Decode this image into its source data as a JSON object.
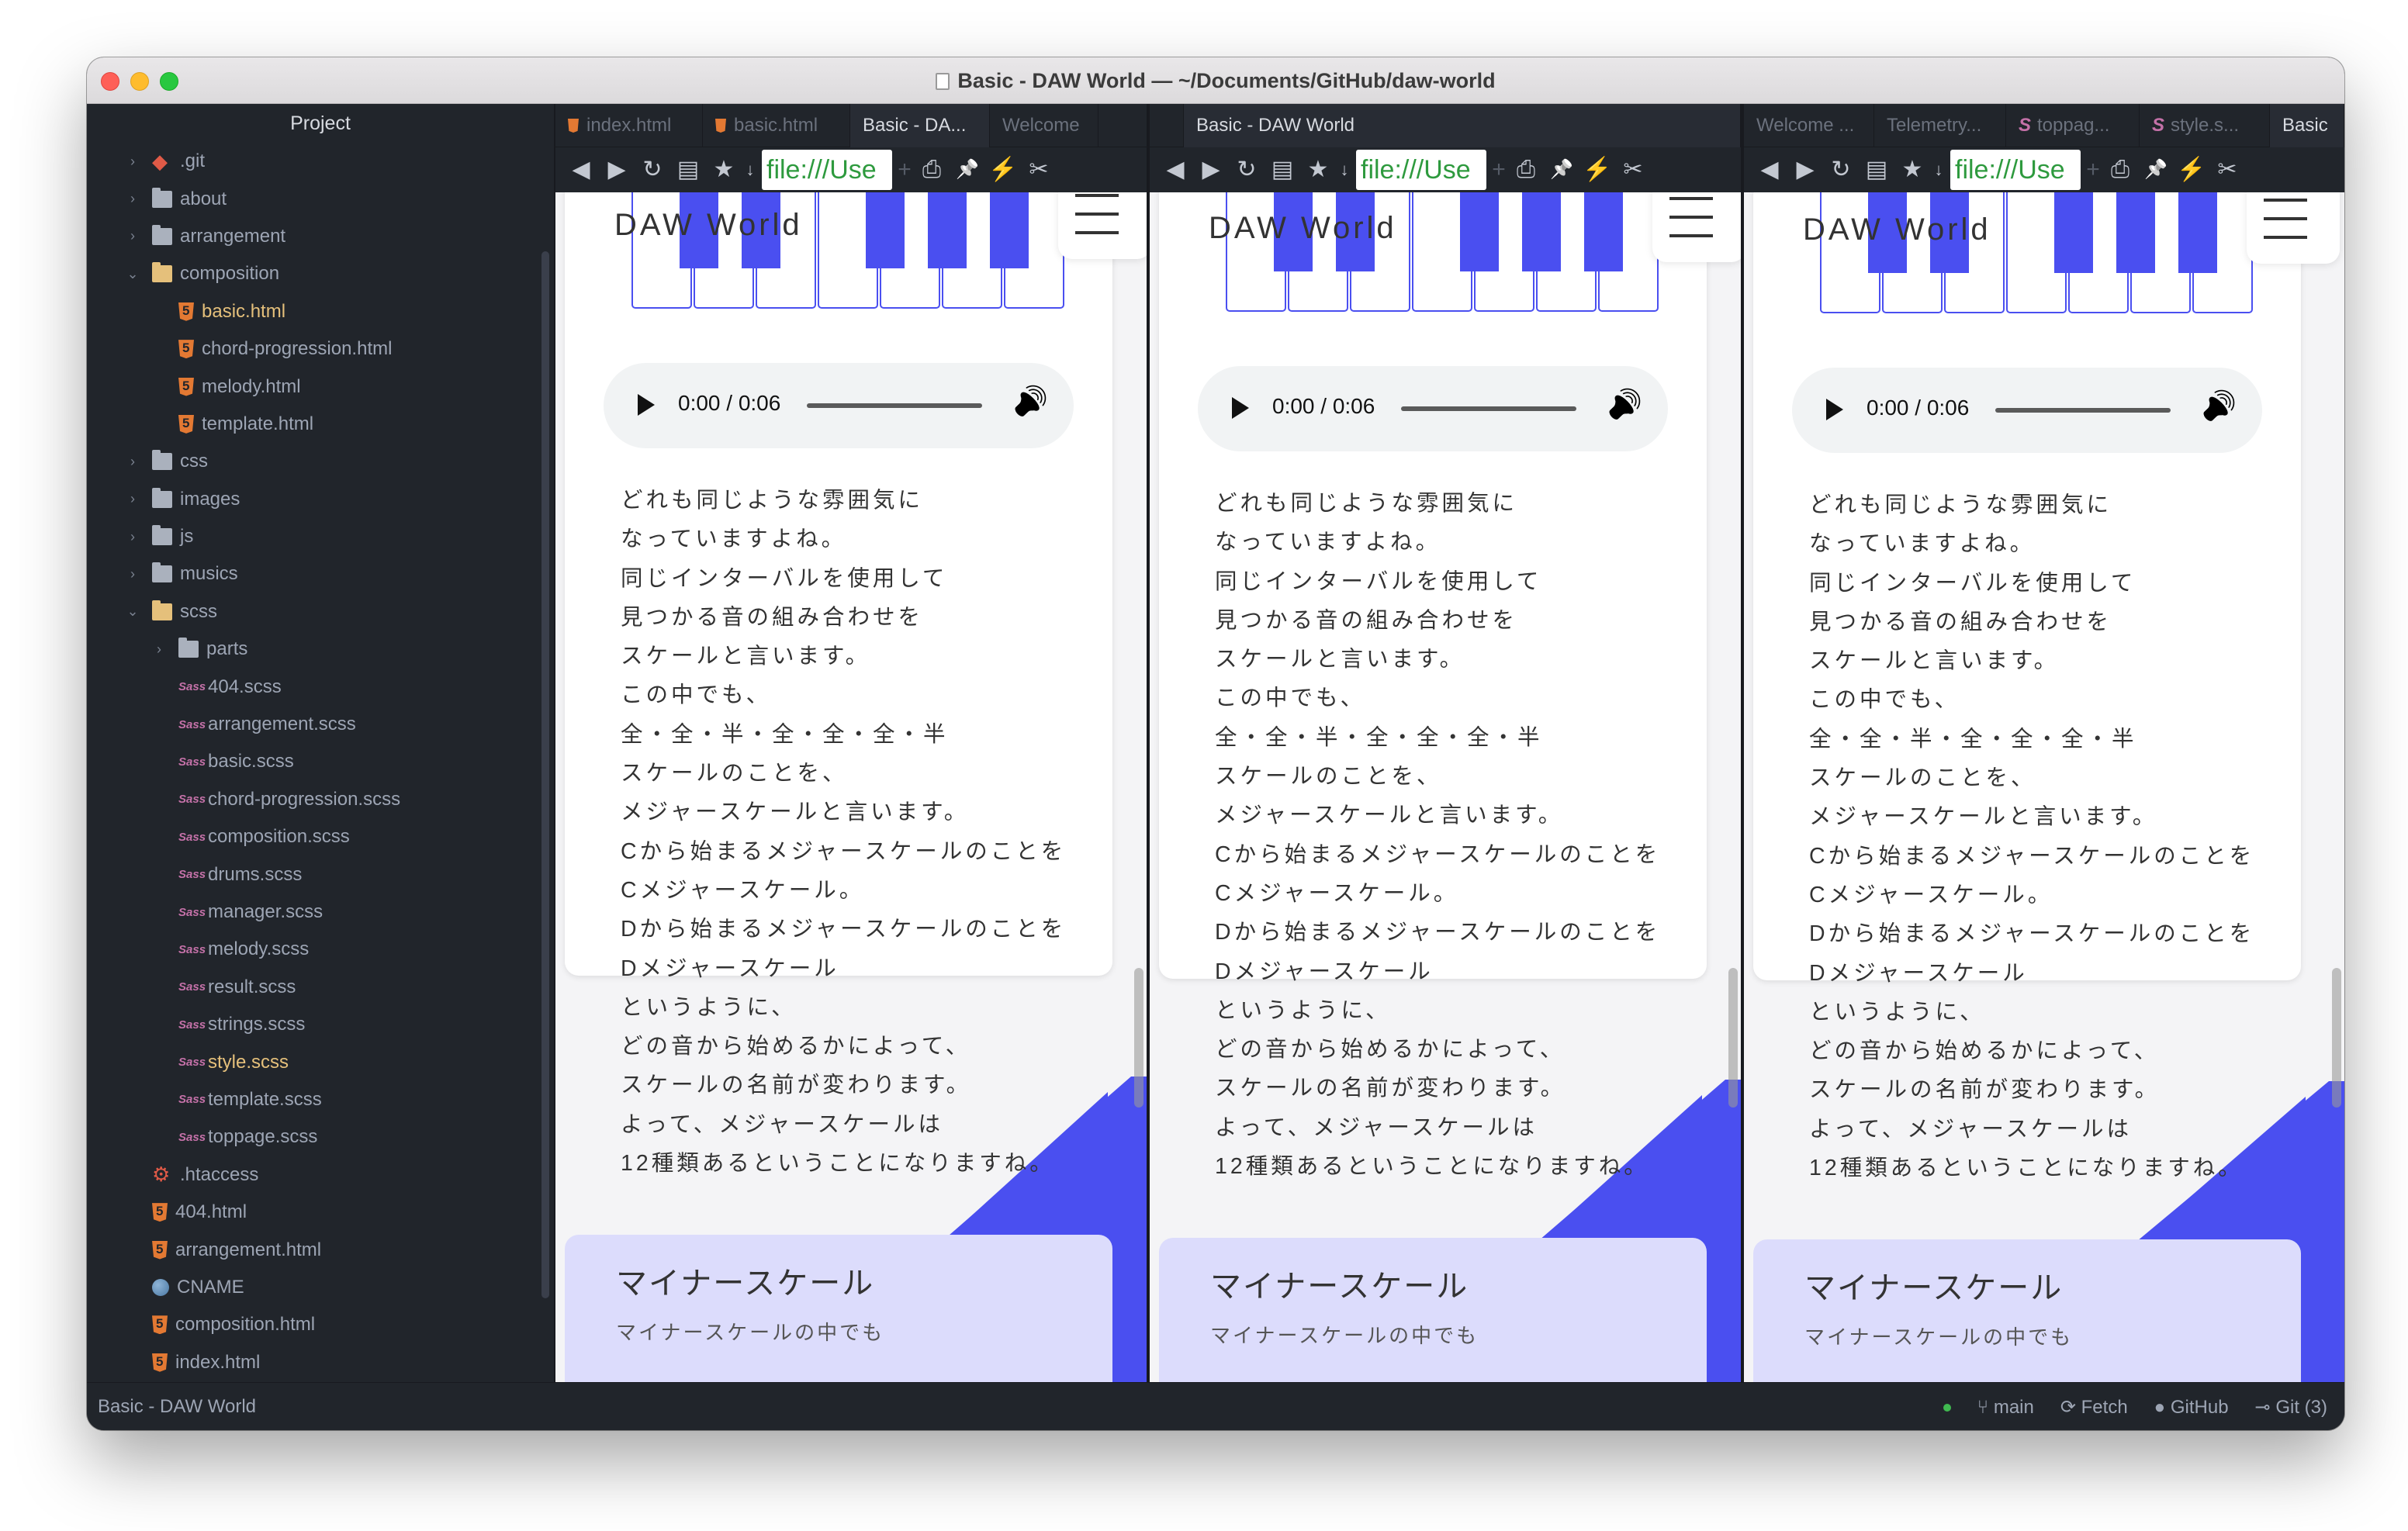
{
  "window": {
    "title": "Basic - DAW World — ~/Documents/GitHub/daw-world"
  },
  "sidebar": {
    "header": "Project",
    "items": [
      {
        "label": ".git",
        "kind": "git",
        "depth": 0,
        "chev": "›"
      },
      {
        "label": "about",
        "kind": "folder",
        "depth": 0,
        "chev": "›"
      },
      {
        "label": "arrangement",
        "kind": "folder",
        "depth": 0,
        "chev": "›"
      },
      {
        "label": "composition",
        "kind": "folder-open",
        "depth": 0,
        "chev": "⌄"
      },
      {
        "label": "basic.html",
        "kind": "html",
        "depth": 1,
        "selected": true
      },
      {
        "label": "chord-progression.html",
        "kind": "html",
        "depth": 1
      },
      {
        "label": "melody.html",
        "kind": "html",
        "depth": 1
      },
      {
        "label": "template.html",
        "kind": "html",
        "depth": 1
      },
      {
        "label": "css",
        "kind": "folder",
        "depth": 0,
        "chev": "›"
      },
      {
        "label": "images",
        "kind": "folder",
        "depth": 0,
        "chev": "›"
      },
      {
        "label": "js",
        "kind": "folder",
        "depth": 0,
        "chev": "›"
      },
      {
        "label": "musics",
        "kind": "folder",
        "depth": 0,
        "chev": "›"
      },
      {
        "label": "scss",
        "kind": "folder-open",
        "depth": 0,
        "chev": "⌄"
      },
      {
        "label": "parts",
        "kind": "folder",
        "depth": 1,
        "chev": "›"
      },
      {
        "label": "404.scss",
        "kind": "sass",
        "depth": 1
      },
      {
        "label": "arrangement.scss",
        "kind": "sass",
        "depth": 1
      },
      {
        "label": "basic.scss",
        "kind": "sass",
        "depth": 1
      },
      {
        "label": "chord-progression.scss",
        "kind": "sass",
        "depth": 1
      },
      {
        "label": "composition.scss",
        "kind": "sass",
        "depth": 1
      },
      {
        "label": "drums.scss",
        "kind": "sass",
        "depth": 1
      },
      {
        "label": "manager.scss",
        "kind": "sass",
        "depth": 1
      },
      {
        "label": "melody.scss",
        "kind": "sass",
        "depth": 1
      },
      {
        "label": "result.scss",
        "kind": "sass",
        "depth": 1
      },
      {
        "label": "strings.scss",
        "kind": "sass",
        "depth": 1
      },
      {
        "label": "style.scss",
        "kind": "sass",
        "depth": 1,
        "selected": true
      },
      {
        "label": "template.scss",
        "kind": "sass",
        "depth": 1
      },
      {
        "label": "toppage.scss",
        "kind": "sass",
        "depth": 1
      },
      {
        "label": ".htaccess",
        "kind": "gear",
        "depth": 0
      },
      {
        "label": "404.html",
        "kind": "html",
        "depth": 0
      },
      {
        "label": "arrangement.html",
        "kind": "html",
        "depth": 0
      },
      {
        "label": "CNAME",
        "kind": "globe",
        "depth": 0
      },
      {
        "label": "composition.html",
        "kind": "html",
        "depth": 0
      },
      {
        "label": "index.html",
        "kind": "html",
        "depth": 0
      }
    ]
  },
  "panes": [
    {
      "tabs": [
        {
          "label": "index.html",
          "icon": "html",
          "active": false
        },
        {
          "label": "basic.html",
          "icon": "html",
          "active": false
        },
        {
          "label": "Basic - DA...",
          "icon": "",
          "active": true
        },
        {
          "label": "Welcome",
          "icon": "",
          "active": false
        }
      ]
    },
    {
      "tabs": [
        {
          "label": "",
          "icon": "",
          "active": false
        },
        {
          "label": "Basic - DAW World",
          "icon": "",
          "active": true
        }
      ]
    },
    {
      "tabs": [
        {
          "label": "Welcome ...",
          "icon": "",
          "active": false
        },
        {
          "label": "Telemetry...",
          "icon": "",
          "active": false
        },
        {
          "label": "toppag...",
          "icon": "sass",
          "active": false
        },
        {
          "label": "style.s...",
          "icon": "sass",
          "active": false
        },
        {
          "label": "Basic",
          "icon": "",
          "active": true
        }
      ]
    }
  ],
  "browser": {
    "url": "file:///Use",
    "toolbar_icons": [
      "back-icon",
      "forward-icon",
      "reload-icon",
      "reader-icon",
      "bookmark-star-icon",
      "bookmark-down-icon",
      "print-icon",
      "pin-icon",
      "lightning-icon",
      "devtools-icon"
    ]
  },
  "page": {
    "site_title": "DAW World",
    "player": {
      "time": "0:00 / 0:06"
    },
    "lyrics": [
      "どれも同じような雰囲気に",
      "なっていますよね。",
      "同じインターバルを使用して",
      "見つかる音の組み合わせを",
      "スケールと言います。",
      "この中でも、",
      "全・全・半・全・全・全・半",
      "スケールのことを、",
      "メジャースケールと言います。",
      "Cから始まるメジャースケールのことを",
      "Cメジャースケール。",
      "Dから始まるメジャースケールのことを",
      "Dメジャースケール",
      "というように、",
      "どの音から始めるかによって、",
      "スケールの名前が変わります。",
      "よって、メジャースケールは",
      "12種類あるということになりますね。"
    ],
    "next_heading": "マイナースケール",
    "next_sub": "マイナースケールの中でも"
  },
  "status": {
    "left": "Basic - DAW World",
    "branch": "main",
    "fetch": "Fetch",
    "github": "GitHub",
    "git": "Git (3)"
  },
  "colors": {
    "accent": "#4a4ff0",
    "sidebar_bg": "#21252b",
    "selected_text": "#e5c07b",
    "url_text": "#2e9a3e"
  }
}
